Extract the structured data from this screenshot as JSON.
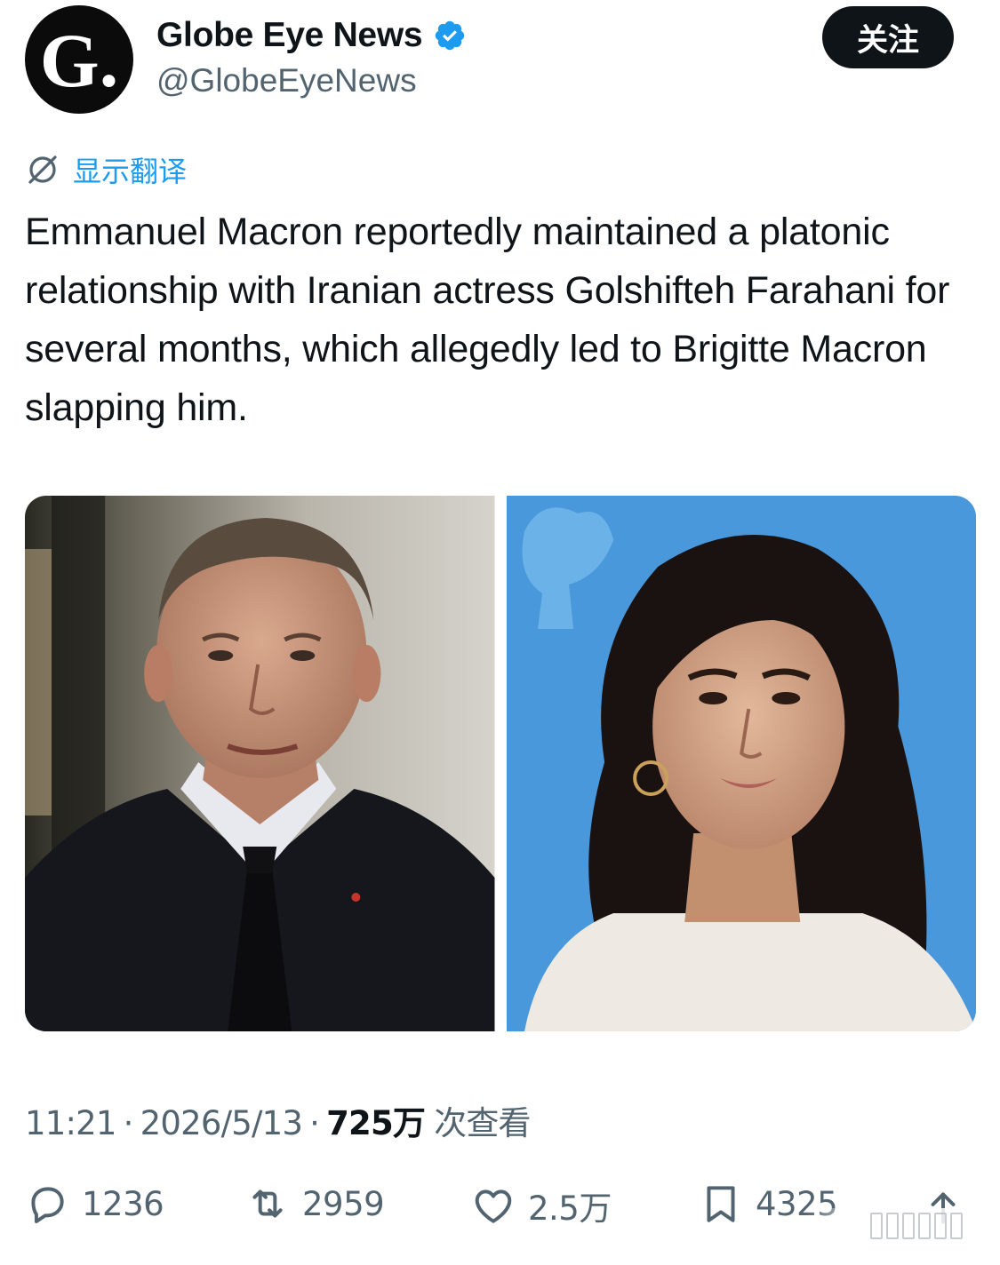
{
  "account": {
    "display_name": "Globe Eye News",
    "handle": "@GlobeEyeNews",
    "avatar_text": "G.",
    "verified": true,
    "follow_label": "关注"
  },
  "translate": {
    "label": "显示翻译",
    "icon": "no-translate-icon"
  },
  "post": {
    "text": "Emmanuel Macron reportedly maintained a platonic relationship with Iranian actress Golshifteh Farahani for several months, which allegedly led to Brigitte Macron slapping him."
  },
  "media": [
    {
      "subject": "man-in-suit-photo"
    },
    {
      "subject": "woman-blue-backdrop-photo"
    }
  ],
  "meta": {
    "time": "11:21",
    "separator": "·",
    "date": "2026/5/13",
    "views": "725万",
    "views_label": "次查看"
  },
  "actions": {
    "replies": "1236",
    "reposts": "2959",
    "likes": "2.5万",
    "bookmarks": "4325"
  },
  "colors": {
    "text": "#0f1419",
    "secondary": "#536471",
    "accent": "#1d9bf0",
    "verified": "#1d9bf0",
    "follow_bg": "#0f1419"
  }
}
